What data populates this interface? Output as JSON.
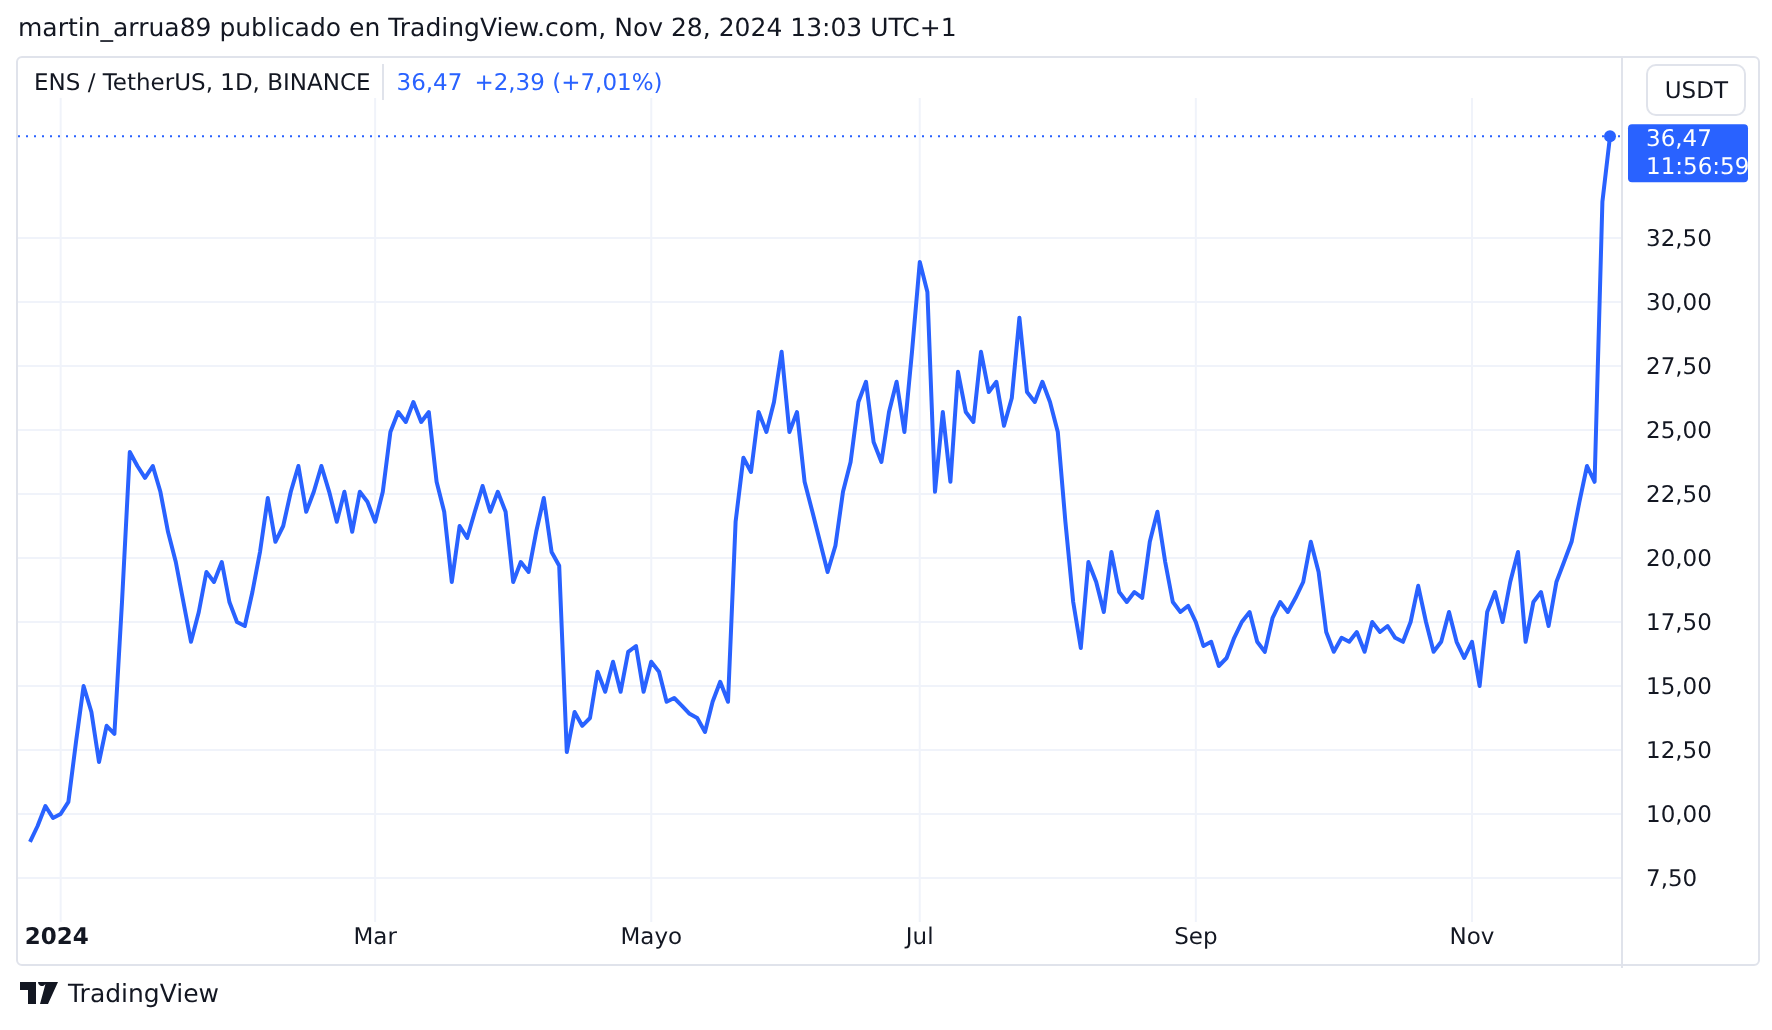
{
  "publisher_line": "martin_arrua89 publicado en TradingView.com, Nov 28, 2024 13:03 UTC+1",
  "legend": {
    "symbol": "ENS / TetherUS, 1D, BINANCE",
    "price": "36,47",
    "change": "+2,39 (+7,01%)"
  },
  "currency_button": "USDT",
  "price_label": {
    "price": "36,47",
    "countdown": "11:56:59"
  },
  "chart_data": {
    "type": "line",
    "categories": [
      null,
      null,
      null,
      null,
      "2024",
      null,
      null,
      null,
      null,
      null,
      null,
      null,
      null,
      null,
      null,
      null,
      null,
      null,
      null,
      null,
      null,
      null,
      null,
      null,
      null,
      null,
      null,
      null,
      null,
      null,
      null,
      null,
      null,
      null,
      null,
      null,
      null,
      null,
      null,
      null,
      null,
      null,
      null,
      null,
      null,
      "Mar",
      null,
      null,
      null,
      null,
      null,
      null,
      null,
      null,
      null,
      null,
      null,
      null,
      null,
      null,
      null,
      null,
      null,
      null,
      null,
      null,
      null,
      null,
      null,
      null,
      null,
      null,
      null,
      null,
      null,
      null,
      null,
      null,
      null,
      null,
      null,
      "Mayo",
      null,
      null,
      null,
      null,
      null,
      null,
      null,
      null,
      null,
      null,
      null,
      null,
      null,
      null,
      null,
      null,
      null,
      null,
      null,
      null,
      null,
      null,
      null,
      null,
      null,
      null,
      null,
      null,
      null,
      null,
      null,
      null,
      null,
      null,
      "Jul",
      null,
      null,
      null,
      null,
      null,
      null,
      null,
      null,
      null,
      null,
      null,
      null,
      null,
      null,
      null,
      null,
      null,
      null,
      null,
      null,
      null,
      null,
      null,
      null,
      null,
      null,
      null,
      null,
      null,
      null,
      null,
      null,
      null,
      null,
      null,
      "Sep",
      null,
      null,
      null,
      null,
      null,
      null,
      null,
      null,
      null,
      null,
      null,
      null,
      null,
      null,
      null,
      null,
      null,
      null,
      null,
      null,
      null,
      null,
      null,
      null,
      null,
      null,
      null,
      null,
      null,
      null,
      null,
      null,
      null,
      null,
      null,
      "Nov",
      null,
      null,
      null,
      null,
      null,
      null,
      null,
      null,
      null,
      null,
      null,
      null,
      null,
      null,
      null,
      null,
      null,
      null
    ],
    "series": [
      {
        "color": "#2962ff",
        "values": [
          8.91,
          9.53,
          10.31,
          9.84,
          10.0,
          10.47,
          12.81,
          15.0,
          13.98,
          12.03,
          13.44,
          13.13,
          18.28,
          24.14,
          23.59,
          23.13,
          23.59,
          22.58,
          21.02,
          19.84,
          18.28,
          16.72,
          17.89,
          19.45,
          19.06,
          19.84,
          18.28,
          17.5,
          17.34,
          18.67,
          20.23,
          22.34,
          20.63,
          21.25,
          22.58,
          23.59,
          21.8,
          22.58,
          23.59,
          22.58,
          21.41,
          22.58,
          21.02,
          22.58,
          22.19,
          21.41,
          22.58,
          24.92,
          25.7,
          25.31,
          26.09,
          25.31,
          25.7,
          22.97,
          21.8,
          19.06,
          21.25,
          20.78,
          21.8,
          22.81,
          21.8,
          22.58,
          21.8,
          19.06,
          19.84,
          19.45,
          21.02,
          22.34,
          20.23,
          19.69,
          12.42,
          13.98,
          13.44,
          13.75,
          15.55,
          14.77,
          15.94,
          14.77,
          16.33,
          16.56,
          14.77,
          15.94,
          15.55,
          14.38,
          14.53,
          14.22,
          13.91,
          13.75,
          13.2,
          14.38,
          15.16,
          14.38,
          21.41,
          23.91,
          23.36,
          25.7,
          24.92,
          26.09,
          28.05,
          24.92,
          25.7,
          22.97,
          21.8,
          20.63,
          19.45,
          20.47,
          22.58,
          23.75,
          26.09,
          26.88,
          24.53,
          23.75,
          25.7,
          26.88,
          24.92,
          28.05,
          31.56,
          30.39,
          22.58,
          25.7,
          22.97,
          27.27,
          25.7,
          25.31,
          28.05,
          26.48,
          26.88,
          25.16,
          26.25,
          29.38,
          26.48,
          26.09,
          26.88,
          26.09,
          24.92,
          21.41,
          18.28,
          16.48,
          19.84,
          19.06,
          17.89,
          20.23,
          18.67,
          18.28,
          18.67,
          18.44,
          20.63,
          21.8,
          19.84,
          18.28,
          17.89,
          18.13,
          17.5,
          16.56,
          16.72,
          15.78,
          16.09,
          16.88,
          17.5,
          17.89,
          16.72,
          16.33,
          17.66,
          18.28,
          17.89,
          18.44,
          19.06,
          20.63,
          19.45,
          17.11,
          16.33,
          16.88,
          16.72,
          17.11,
          16.33,
          17.5,
          17.11,
          17.34,
          16.88,
          16.72,
          17.5,
          18.91,
          17.5,
          16.33,
          16.72,
          17.89,
          16.72,
          16.09,
          16.72,
          15.0,
          17.89,
          18.67,
          17.5,
          19.06,
          20.23,
          16.72,
          18.28,
          18.67,
          17.34,
          19.06,
          19.84,
          20.63,
          22.19,
          23.59,
          22.97,
          33.91,
          36.47
        ]
      }
    ],
    "ylim": [
      3.98,
      39.53
    ],
    "yticks": [
      {
        "value": 7.5,
        "label": "7,50"
      },
      {
        "value": 10,
        "label": "10,00"
      },
      {
        "value": 12.5,
        "label": "12,50"
      },
      {
        "value": 15,
        "label": "15,00"
      },
      {
        "value": 17.5,
        "label": "17,50"
      },
      {
        "value": 20,
        "label": "20,00"
      },
      {
        "value": 22.5,
        "label": "22,50"
      },
      {
        "value": 25,
        "label": "25,00"
      },
      {
        "value": 27.5,
        "label": "27,50"
      },
      {
        "value": 30,
        "label": "30,00"
      },
      {
        "value": 32.5,
        "label": "32,50"
      }
    ],
    "grid": true,
    "ref_lines": [
      {
        "axis": "y",
        "value": 36.47,
        "color": "#2962ff"
      }
    ]
  },
  "footer_logo": "TradingView"
}
